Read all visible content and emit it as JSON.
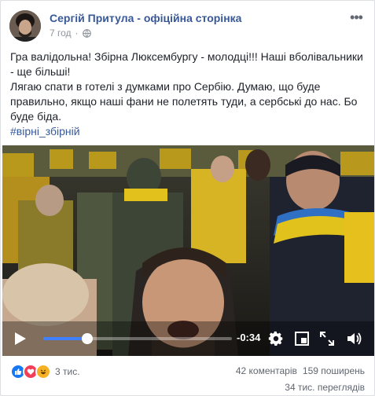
{
  "post": {
    "author": "Сергій Притула - офіційна сторінка",
    "time": "7 год",
    "text_lines": [
      "Гра валідольна! Збірна Люксембургу - молодці!!! Наші вболівальники - ще більші!",
      "Лягаю спати в готелі з думками про Сербію. Думаю, що буде правильно, якщо наші фани не полетять туди, а сербські до нас. Бо буде біда."
    ],
    "hashtag": "#вірні_збірній"
  },
  "video": {
    "time_remaining": "-0:34",
    "progress": 0.235
  },
  "stats": {
    "reactions_count": "3 тис.",
    "comments": "42 коментарів",
    "shares": "159 поширень",
    "views": "34 тис. переглядів"
  },
  "colors": {
    "link": "#385898",
    "like": "#1877f2",
    "love": "#f33e58",
    "haha": "#f7b125",
    "scrubber": "#4080ff"
  },
  "icons": [
    "globe-icon",
    "more-icon",
    "play-icon",
    "settings-icon",
    "exit-fullscreen-icon",
    "fullscreen-icon",
    "volume-icon",
    "like-icon",
    "love-icon",
    "haha-icon"
  ]
}
